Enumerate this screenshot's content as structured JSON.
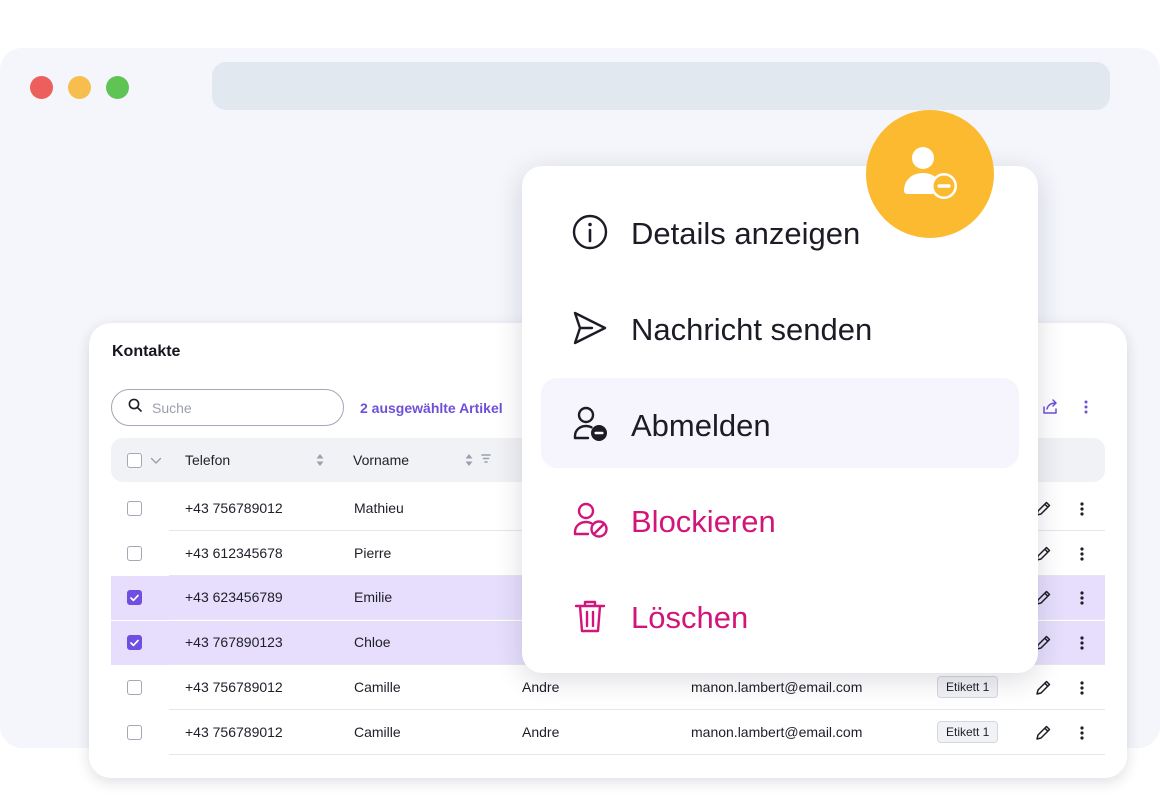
{
  "colors": {
    "accent": "#6f4ee2",
    "selected_row": "#e6defc",
    "danger": "#d2157a",
    "badge": "#fbba30",
    "window_red": "#ec5f5b",
    "window_yellow": "#f6be4f",
    "window_green": "#60c454"
  },
  "contacts": {
    "title": "Kontakte",
    "search_placeholder": "Suche",
    "selected_info": "2 ausgewählte Artikel",
    "columns": [
      "Telefon",
      "Vorname"
    ],
    "rows": [
      {
        "phone": "+43 756789012",
        "first": "Mathieu",
        "last": "",
        "email": "",
        "tag": "",
        "selected": false
      },
      {
        "phone": "+43 612345678",
        "first": "Pierre",
        "last": "",
        "email": "",
        "tag": "",
        "selected": false
      },
      {
        "phone": "+43 623456789",
        "first": "Emilie",
        "last": "",
        "email": "",
        "tag": "",
        "selected": true
      },
      {
        "phone": "+43 767890123",
        "first": "Chloe",
        "last": "",
        "email": "",
        "tag": "",
        "selected": true
      },
      {
        "phone": "+43 756789012",
        "first": "Camille",
        "last": "Andre",
        "email": "manon.lambert@email.com",
        "tag": "Etikett 1",
        "selected": false
      },
      {
        "phone": "+43 756789012",
        "first": "Camille",
        "last": "Andre",
        "email": "manon.lambert@email.com",
        "tag": "Etikett 1",
        "selected": false
      }
    ]
  },
  "menu": {
    "items": [
      {
        "label": "Details anzeigen",
        "icon": "info-icon",
        "active": false,
        "danger": false
      },
      {
        "label": "Nachricht senden",
        "icon": "send-icon",
        "active": false,
        "danger": false
      },
      {
        "label": "Abmelden",
        "icon": "user-minus-icon",
        "active": true,
        "danger": false
      },
      {
        "label": "Blockieren",
        "icon": "user-block-icon",
        "active": false,
        "danger": true
      },
      {
        "label": "Löschen",
        "icon": "trash-icon",
        "active": false,
        "danger": true
      }
    ]
  },
  "badge": {
    "icon": "user-minus-icon"
  }
}
